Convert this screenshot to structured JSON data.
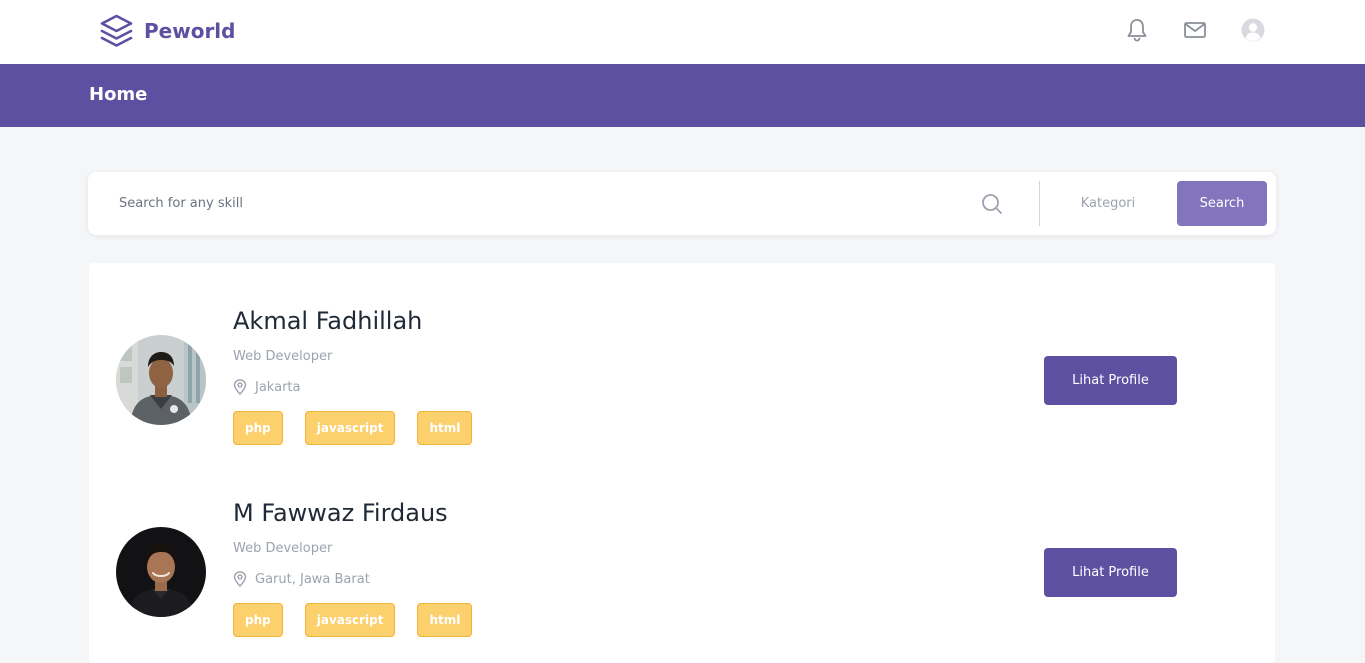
{
  "brand": {
    "name": "Peworld",
    "icon": "layers-icon"
  },
  "navbar": {
    "icons": [
      "bell-icon",
      "mail-icon",
      "user-avatar-icon"
    ]
  },
  "header": {
    "title": "Home"
  },
  "search": {
    "placeholder": "Search for any skill",
    "value": "",
    "icon": "search-icon",
    "category_label": "Kategori",
    "button_label": "Search"
  },
  "talents": [
    {
      "name": "Akmal Fadhillah",
      "job": "Web Developer",
      "location": "Jakarta",
      "skills": [
        "php",
        "javascript",
        "html"
      ],
      "button_label": "Lihat Profile"
    },
    {
      "name": "M Fawwaz Firdaus",
      "job": "Web Developer",
      "location": "Garut, Jawa Barat",
      "skills": [
        "php",
        "javascript",
        "html"
      ],
      "button_label": "Lihat Profile"
    }
  ],
  "colors": {
    "brand": "#5e50a1",
    "search_button": "#8274bd",
    "skill_badge": "#fbd06d",
    "skill_border": "#f3b23a",
    "page_background": "#f5f6f8"
  }
}
